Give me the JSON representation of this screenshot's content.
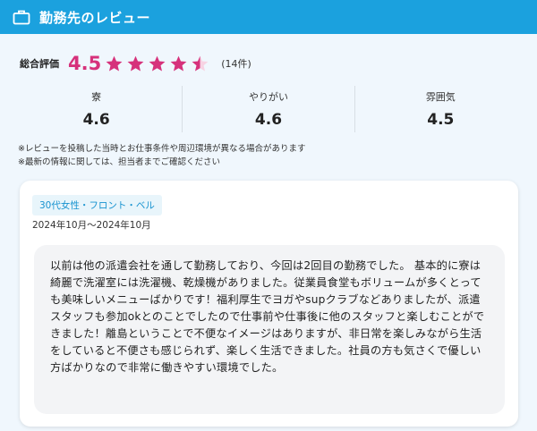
{
  "header": {
    "title": "勤務先のレビュー",
    "icon": "briefcase-icon",
    "background": "#1ba1de"
  },
  "summary": {
    "label": "総合評価",
    "score": "4.5",
    "rating_value": 4.5,
    "rating_max": 5,
    "count": "(14件)",
    "accent_color": "#d6317b"
  },
  "metrics": [
    {
      "label": "寮",
      "value": "4.6"
    },
    {
      "label": "やりがい",
      "value": "4.6"
    },
    {
      "label": "雰囲気",
      "value": "4.5"
    }
  ],
  "notes": [
    "※レビューを投稿した当時とお仕事条件や周辺環境が異なる場合があります",
    "※最新の情報に関しては、担当者までご確認ください"
  ],
  "review": {
    "tag": "30代女性・フロント・ベル",
    "period": "2024年10月～2024年10月",
    "body": "以前は他の派遣会社を通して勤務しており、今回は2回目の勤務でした。 基本的に寮は綺麗で洗濯室には洗濯機、乾燥機がありました。従業員食堂もボリュームが多くとっても美味しいメニューばかりです！福利厚生でヨガやsupクラブなどありましたが、派遣スタッフも参加okとのことでしたので仕事前や仕事後に他のスタッフと楽しむことができました！離島ということで不便なイメージはありますが、非日常を楽しみながら生活をしていると不便さも感じられず、楽しく生活できました。社員の方も気さくで優しい方ばかりなので非常に働きやすい環境でした。"
  }
}
